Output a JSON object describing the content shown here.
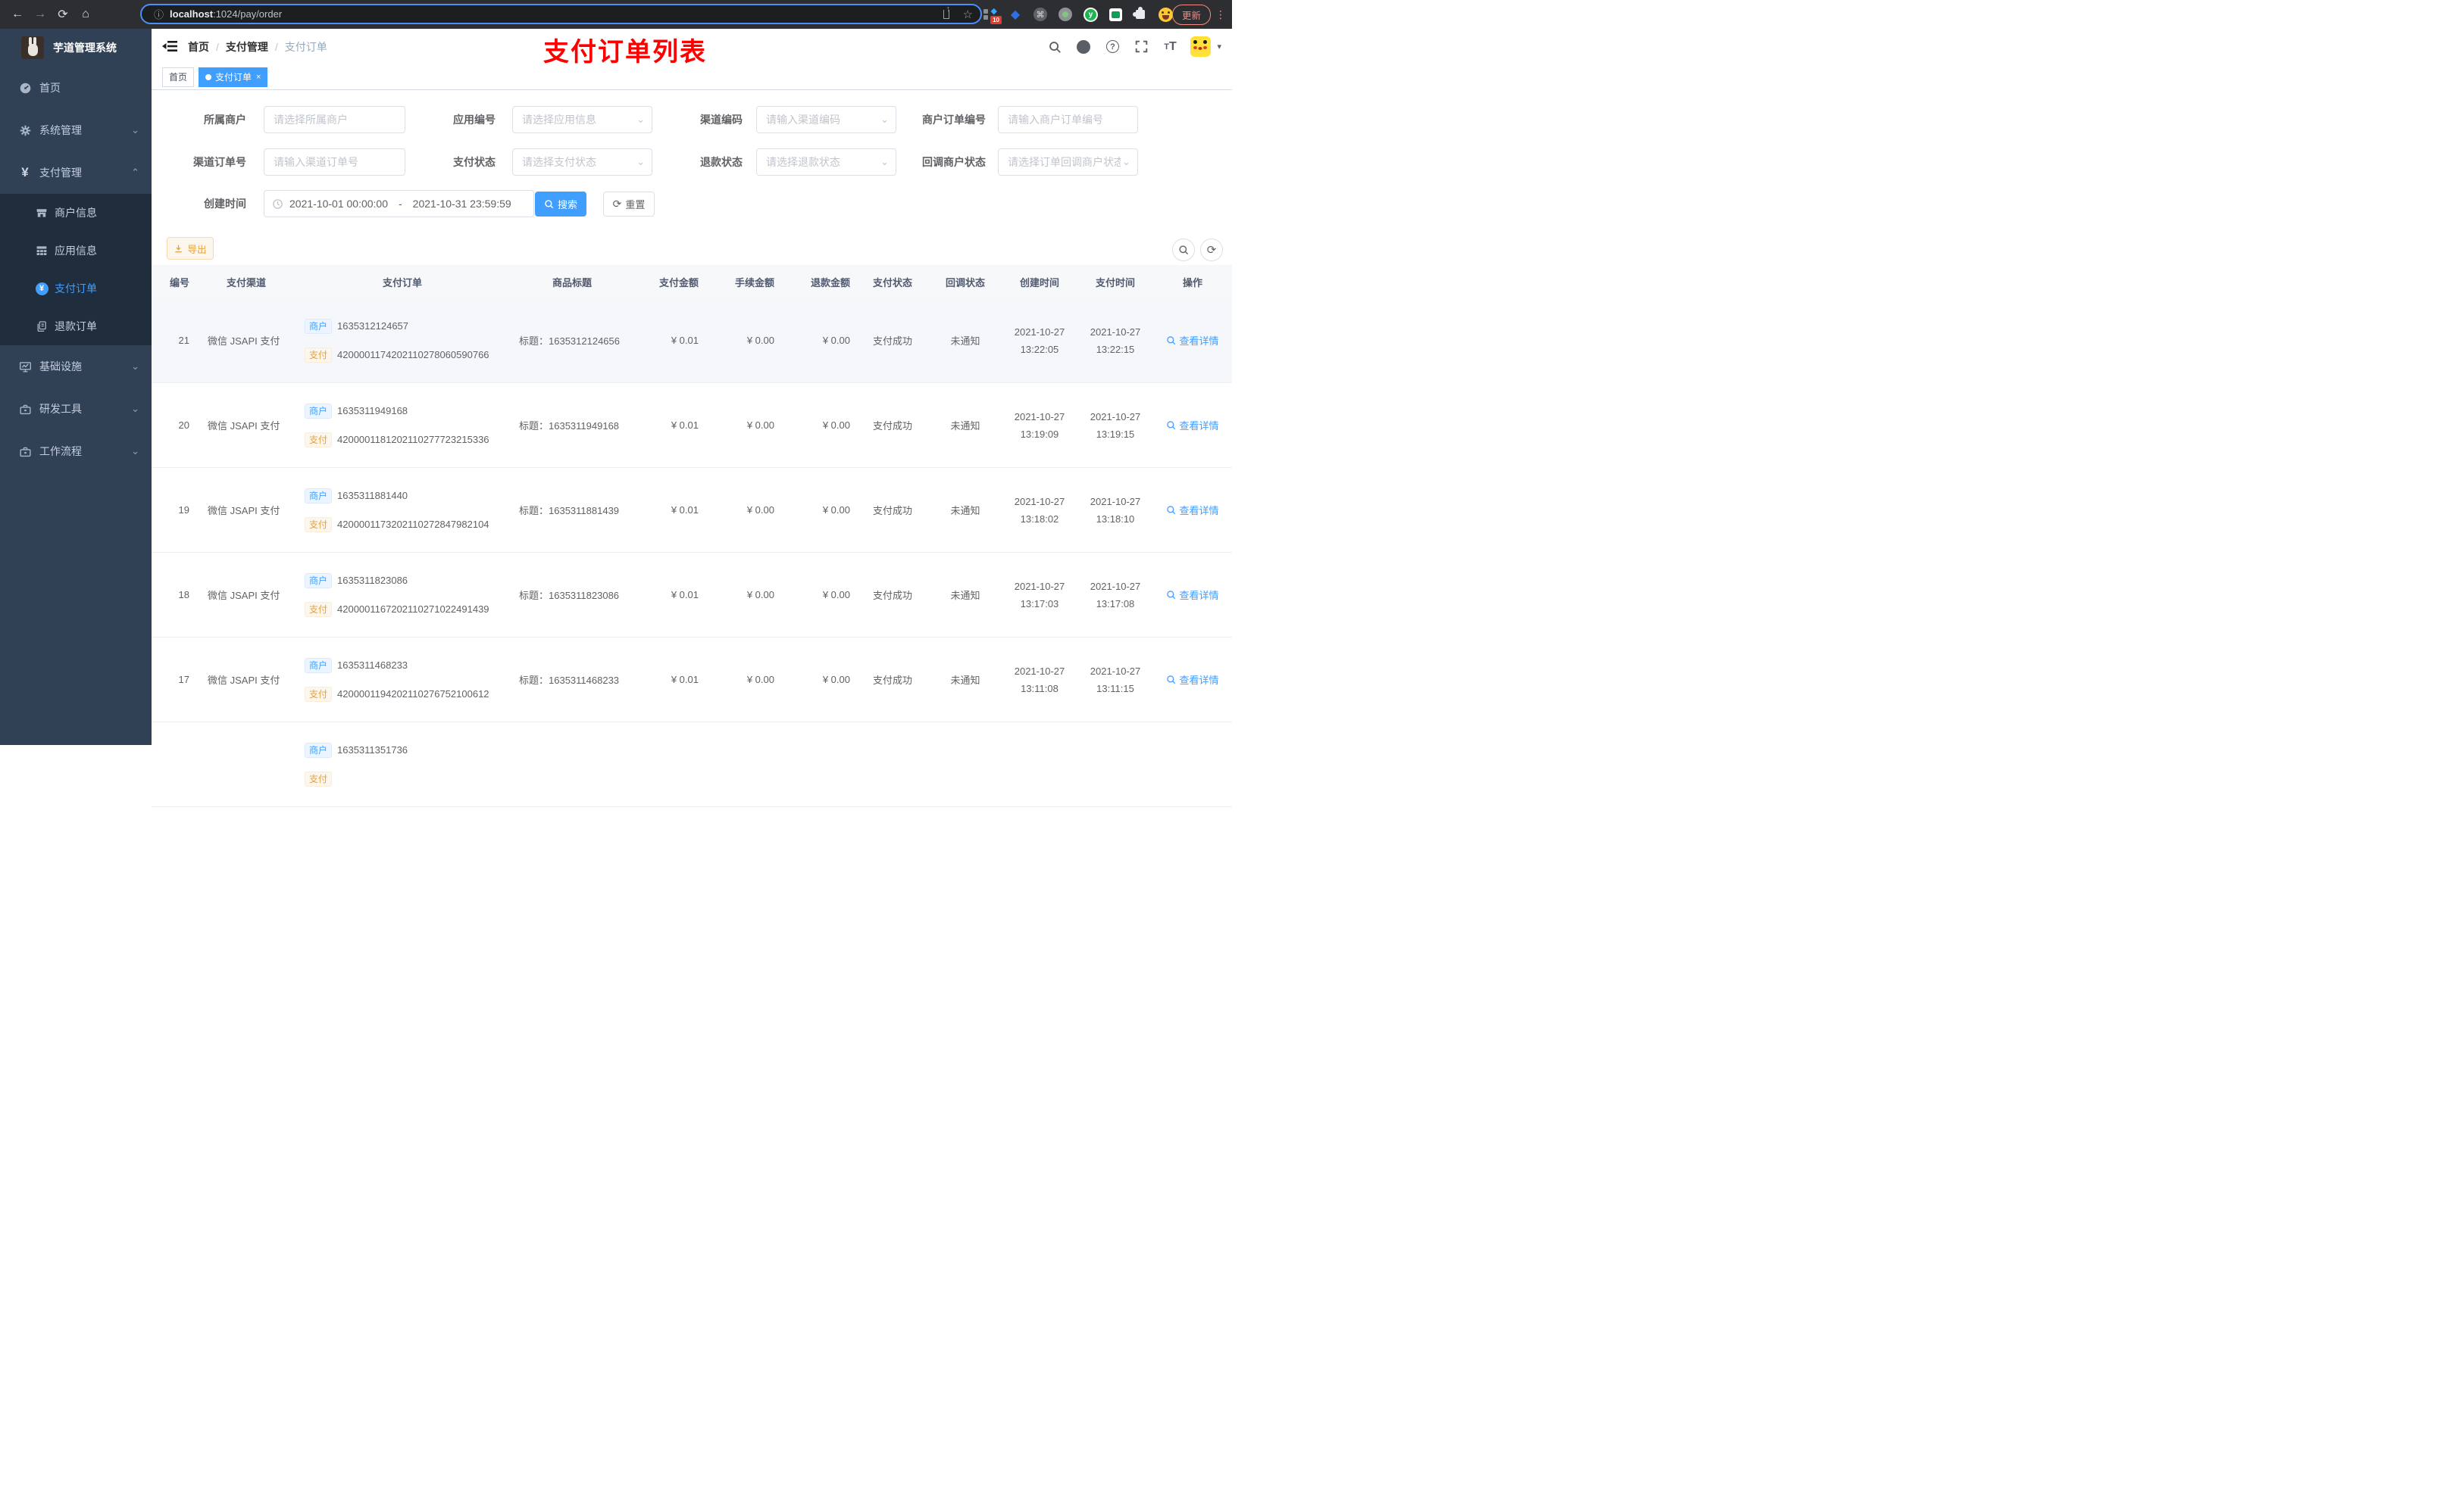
{
  "colors": {
    "accent": "#409EFF",
    "warning": "#E6A23C",
    "annotation_red": "#FE0000",
    "sidebar_bg": "#304156",
    "submenu_bg": "#1F2D3D"
  },
  "browser": {
    "url_host": "localhost",
    "url_rest": ":1024/pay/order",
    "update_label": "更新",
    "extension_badge": "10"
  },
  "sidebar": {
    "title": "芋道管理系统",
    "menu": {
      "home": "首页",
      "system": "系统管理",
      "payment": "支付管理",
      "merchant_info": "商户信息",
      "app_info": "应用信息",
      "pay_order": "支付订单",
      "refund_order": "退款订单",
      "infra": "基础设施",
      "dev_tools": "研发工具",
      "workflow": "工作流程"
    }
  },
  "header": {
    "breadcrumb": {
      "home": "首页",
      "section": "支付管理",
      "current": "支付订单"
    },
    "annotation": "支付订单列表"
  },
  "tabs": {
    "home": "首页",
    "current": "支付订单"
  },
  "filters": {
    "merchant": {
      "label": "所属商户",
      "placeholder": "请选择所属商户"
    },
    "app": {
      "label": "应用编号",
      "placeholder": "请选择应用信息"
    },
    "channel_code": {
      "label": "渠道编码",
      "placeholder": "请输入渠道编码"
    },
    "merchant_order_no": {
      "label": "商户订单编号",
      "placeholder": "请输入商户订单编号"
    },
    "channel_order_no": {
      "label": "渠道订单号",
      "placeholder": "请输入渠道订单号"
    },
    "pay_status": {
      "label": "支付状态",
      "placeholder": "请选择支付状态"
    },
    "refund_status": {
      "label": "退款状态",
      "placeholder": "请选择退款状态"
    },
    "notify_status": {
      "label": "回调商户状态",
      "placeholder": "请选择订单回调商户状态"
    },
    "create_time": {
      "label": "创建时间",
      "start": "2021-10-01 00:00:00",
      "separator": "-",
      "end": "2021-10-31 23:59:59"
    }
  },
  "buttons": {
    "search": "搜索",
    "reset": "重置",
    "export": "导出"
  },
  "table": {
    "tag_merchant": "商户",
    "tag_pay": "支付",
    "columns": {
      "id": "编号",
      "channel": "支付渠道",
      "order": "支付订单",
      "title": "商品标题",
      "amount": "支付金额",
      "fee": "手续金额",
      "refund": "退款金额",
      "pay_status": "支付状态",
      "notify_status": "回调状态",
      "create_time": "创建时间",
      "pay_time": "支付时间",
      "action": "操作"
    },
    "rows": [
      {
        "id": "21",
        "channel": "微信 JSAPI 支付",
        "merchant_no": "1635312124657",
        "pay_no": "4200001174202110278060590766",
        "title": "标题：1635312124656",
        "amount": "¥ 0.01",
        "fee": "¥ 0.00",
        "refund": "¥ 0.00",
        "pay_status": "支付成功",
        "notify_status": "未通知",
        "create_date": "2021-10-27",
        "create_clock": "13:22:05",
        "pay_date": "2021-10-27",
        "pay_clock": "13:22:15",
        "action": "查看详情"
      },
      {
        "id": "20",
        "channel": "微信 JSAPI 支付",
        "merchant_no": "1635311949168",
        "pay_no": "4200001181202110277723215336",
        "title": "标题：1635311949168",
        "amount": "¥ 0.01",
        "fee": "¥ 0.00",
        "refund": "¥ 0.00",
        "pay_status": "支付成功",
        "notify_status": "未通知",
        "create_date": "2021-10-27",
        "create_clock": "13:19:09",
        "pay_date": "2021-10-27",
        "pay_clock": "13:19:15",
        "action": "查看详情"
      },
      {
        "id": "19",
        "channel": "微信 JSAPI 支付",
        "merchant_no": "1635311881440",
        "pay_no": "4200001173202110272847982104",
        "title": "标题：1635311881439",
        "amount": "¥ 0.01",
        "fee": "¥ 0.00",
        "refund": "¥ 0.00",
        "pay_status": "支付成功",
        "notify_status": "未通知",
        "create_date": "2021-10-27",
        "create_clock": "13:18:02",
        "pay_date": "2021-10-27",
        "pay_clock": "13:18:10",
        "action": "查看详情"
      },
      {
        "id": "18",
        "channel": "微信 JSAPI 支付",
        "merchant_no": "1635311823086",
        "pay_no": "4200001167202110271022491439",
        "title": "标题：1635311823086",
        "amount": "¥ 0.01",
        "fee": "¥ 0.00",
        "refund": "¥ 0.00",
        "pay_status": "支付成功",
        "notify_status": "未通知",
        "create_date": "2021-10-27",
        "create_clock": "13:17:03",
        "pay_date": "2021-10-27",
        "pay_clock": "13:17:08",
        "action": "查看详情"
      },
      {
        "id": "17",
        "channel": "微信 JSAPI 支付",
        "merchant_no": "1635311468233",
        "pay_no": "4200001194202110276752100612",
        "title": "标题：1635311468233",
        "amount": "¥ 0.01",
        "fee": "¥ 0.00",
        "refund": "¥ 0.00",
        "pay_status": "支付成功",
        "notify_status": "未通知",
        "create_date": "2021-10-27",
        "create_clock": "13:11:08",
        "pay_date": "2021-10-27",
        "pay_clock": "13:11:15",
        "action": "查看详情"
      },
      {
        "id": "",
        "channel": "",
        "merchant_no": "1635311351736",
        "pay_no": "",
        "title": "",
        "amount": "",
        "fee": "",
        "refund": "",
        "pay_status": "",
        "notify_status": "",
        "create_date": "",
        "create_clock": "",
        "pay_date": "",
        "pay_clock": "",
        "action": ""
      }
    ]
  }
}
